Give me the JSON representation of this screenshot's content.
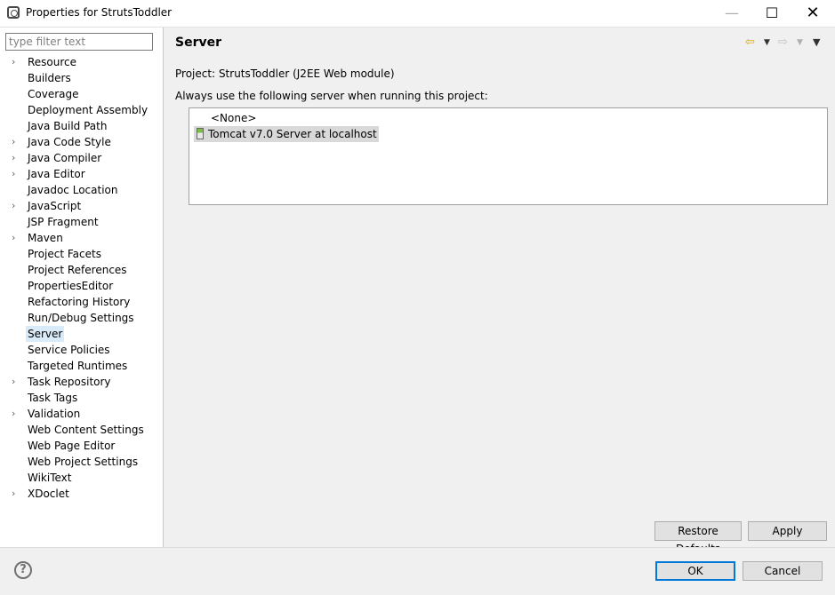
{
  "window": {
    "title": "Properties for StrutsToddler",
    "minimize": "—",
    "maximize": "☐",
    "close": "✕"
  },
  "filter": {
    "placeholder": "type filter text",
    "value": ""
  },
  "tree": [
    {
      "label": "Resource",
      "expandable": true
    },
    {
      "label": "Builders",
      "expandable": false
    },
    {
      "label": "Coverage",
      "expandable": false
    },
    {
      "label": "Deployment Assembly",
      "expandable": false
    },
    {
      "label": "Java Build Path",
      "expandable": false
    },
    {
      "label": "Java Code Style",
      "expandable": true
    },
    {
      "label": "Java Compiler",
      "expandable": true
    },
    {
      "label": "Java Editor",
      "expandable": true
    },
    {
      "label": "Javadoc Location",
      "expandable": false
    },
    {
      "label": "JavaScript",
      "expandable": true
    },
    {
      "label": "JSP Fragment",
      "expandable": false
    },
    {
      "label": "Maven",
      "expandable": true
    },
    {
      "label": "Project Facets",
      "expandable": false
    },
    {
      "label": "Project References",
      "expandable": false
    },
    {
      "label": "PropertiesEditor",
      "expandable": false
    },
    {
      "label": "Refactoring History",
      "expandable": false
    },
    {
      "label": "Run/Debug Settings",
      "expandable": false
    },
    {
      "label": "Server",
      "expandable": false,
      "selected": true
    },
    {
      "label": "Service Policies",
      "expandable": false
    },
    {
      "label": "Targeted Runtimes",
      "expandable": false
    },
    {
      "label": "Task Repository",
      "expandable": true
    },
    {
      "label": "Task Tags",
      "expandable": false
    },
    {
      "label": "Validation",
      "expandable": true
    },
    {
      "label": "Web Content Settings",
      "expandable": false
    },
    {
      "label": "Web Page Editor",
      "expandable": false
    },
    {
      "label": "Web Project Settings",
      "expandable": false
    },
    {
      "label": "WikiText",
      "expandable": false
    },
    {
      "label": "XDoclet",
      "expandable": true
    }
  ],
  "page": {
    "title": "Server",
    "project_label": "Project:",
    "project_value": "StrutsToddler (J2EE Web module)",
    "instruction": "Always use the following server when running this project:",
    "servers": [
      {
        "label": "<None>",
        "selected": false
      },
      {
        "label": "Tomcat v7.0 Server at localhost",
        "selected": true
      }
    ],
    "restore_defaults": "Restore Defaults",
    "apply": "Apply"
  },
  "nav": {
    "back_icon": "⇦",
    "forward_icon": "⇨",
    "dropdown": "▼",
    "menu": "▼"
  },
  "footer": {
    "help": "?",
    "ok": "OK",
    "cancel": "Cancel"
  },
  "colors": {
    "selection": "#d9ebf9",
    "accent": "#0078d7",
    "nav_back": "#e5a100"
  }
}
